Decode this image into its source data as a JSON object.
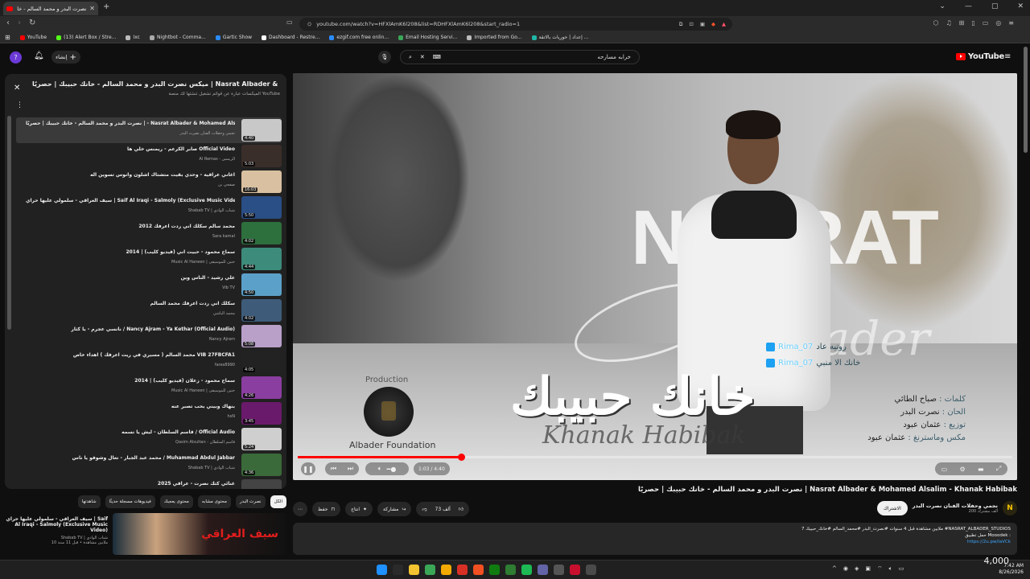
{
  "browser": {
    "tab_title": "نصرت البدر و محمد السالم - خا",
    "url": "youtube.com/watch?v=HFXlAmK6l208&list=RDHFXlAmK6l208&start_radio=1",
    "bookmarks": [
      "YouTube",
      "(13) Alert Box / Stre...",
      "Ixc",
      "Nightbot - Comma...",
      "Gartic Show",
      "Dashboard - Restre...",
      "ezgif.com free onlin...",
      "Email Hosting Servi...",
      "Imported from Go...",
      "إعداد | حوريات بالاتقة ..."
    ],
    "bookmark_colors": [
      "#ff0000",
      "#53fc18",
      "#bbbbbb",
      "#aaaaaa",
      "#2a8cff",
      "#ffffff",
      "#2a8cff",
      "#3aa757",
      "#bbbbbb",
      "#1fb6a8"
    ]
  },
  "masthead": {
    "create_label": "إنشاء",
    "search_value": "خرابه مسارحه",
    "logo_text": "YouTube"
  },
  "playlist": {
    "title": "ميكس نصرت البدر و محمد السالم - خانك حبيبك | حصريًا | Nasrat Albader & Mohamed Alsalim - Khanak Habibak",
    "subtitle": "الميكسات عبارة عن قوائم تشغيل تنشئها لك منصة YouTube",
    "items": [
      {
        "title": "نصرت البدر و محمد السالم - خانك حبيبك | حصريًا | - Nasrat Albader & Mohamed Alsalim - Khanak Habibak",
        "channel": "نجمي وحفلات الفنان نصرت البدر",
        "duration": "4:40",
        "color": "#c8c8c8"
      },
      {
        "title": "صابر الكرعم - ريمنس خلي ها Official Video",
        "channel": "Al Remas - الريمس",
        "duration": "5:03",
        "color": "#3a2e2a"
      },
      {
        "title": "اغاني عراقية - وحدي بقيت متشتاك اشلون وانوس تسوين اله",
        "channel": "صفحي بن",
        "duration": "16:03",
        "color": "#d9c0a0"
      },
      {
        "title": "سيف العراقي - سلمولي عليها حراي | Saif Al Iraqi - Salmoly (Exclusive Music Video)",
        "channel": "Shabab TV | شباب الوادي",
        "duration": "5:50",
        "color": "#2a4e86"
      },
      {
        "title": "محمد سالم سكلك اني ردت اعرفك 2012",
        "channel": "Sara kamal",
        "duration": "4:02",
        "color": "#2e6f3e"
      },
      {
        "title": "سماح محمود - حبيت اني (فيديو كليب) | 2014",
        "channel": "Music Al Haneen | حنين للموسيقى",
        "duration": "4:44",
        "color": "#3d8b7a"
      },
      {
        "title": "علي رشيد - الناس وين",
        "channel": "Vib TV",
        "duration": "4:50",
        "color": "#5aa0c8"
      },
      {
        "title": "سكلك اني ردت اعرفك محمد السالم",
        "channel": "محمد الباشي",
        "duration": "4:02",
        "color": "#3e5c7a"
      },
      {
        "title": "نانسي عجرم - يا كثار / Nancy Ajram - Ya Kethar (Official Audio)",
        "channel": "Nancy Ajram",
        "duration": "5:08",
        "color": "#b8a0c8"
      },
      {
        "title": "محمد السالم ( مسيري في ريت اعرفك ) اهداء خاص VIB 27FBCFA1",
        "channel": "fares8990",
        "duration": "4:05",
        "color": "#222222"
      },
      {
        "title": "سماح محمود - زعلان (فيديو كليب) | 2014",
        "channel": "Music Al Haneen | حنين للموسيقى",
        "duration": "4:26",
        "color": "#8a3ea0"
      },
      {
        "title": "بنهاك وبيني بحب تصبر عنه",
        "channel": "hsN",
        "duration": "3:45",
        "color": "#6a1a6a"
      },
      {
        "title": "قاسم السلطان - ليش يا نسمه / Official Audio",
        "channel": "Qasim Alsultan - قاسم السلطان",
        "duration": "5:24",
        "color": "#cfcfcf"
      },
      {
        "title": "محمد عبد الجبار - تعال وشوفو يا ناس / Muhammad Abdul Jabbar",
        "channel": "Shabab TV | شباب الوادي",
        "duration": "4:36",
        "color": "#3a6a3a"
      },
      {
        "title": "غنائي كتك نصرت - عراقي 2025",
        "channel": "",
        "duration": "",
        "color": "#444444"
      }
    ]
  },
  "chips": [
    "الكل",
    "نصرت البدر",
    "محتوى مشابه",
    "محتوى يعجبك",
    "فيديوهات مسجلة حديثًا",
    "شاهدتها"
  ],
  "recommended": {
    "title": "سيف العراقي - سلمولي عليها حراي | Saif Al Iraqi - Salmoly (Exclusive Music Video)",
    "channel": "Shabab TV | شباب الوادي",
    "meta": "10 ملايين مشاهدة • قبل 11 سنة",
    "thumb_text": "سيف العراقي"
  },
  "player": {
    "production_label": "Production",
    "foundation": "Albader Foundation",
    "overlay_name": "NASRAT",
    "signature": "Albader",
    "song_ar": "خانك حبيبك",
    "song_en": "Khanak Habibak",
    "credits": [
      {
        "k": "كلمات :",
        "v": "صباح الطائي"
      },
      {
        "k": "الحان :",
        "v": "نصرت البدر"
      },
      {
        "k": "توزيع :",
        "v": "عثمان عبود"
      },
      {
        "k": "مكس وماسترنغ :",
        "v": "عثمان عبود"
      }
    ],
    "social": [
      {
        "handle": "Rima_07",
        "label": "روتيه عاد"
      },
      {
        "handle": "Rima_07",
        "label": "خانك الا منبي"
      }
    ],
    "time": "1:03 / 4:40",
    "progress": 0.2284
  },
  "video": {
    "title": "نصرت البدر و محمد السالم - خانك حبيبك | حصريًا | Nasrat Albader & Mohamed Alsalim - Khanak Habibak",
    "likes": "73 ألف",
    "share": "مشاركة",
    "clip": "انتاج",
    "save": "حفظ",
    "channel_name": "نجمي وحفلات الفنان نصرت البدر",
    "channel_subs": "200 ألف مشترك",
    "subscribe": "الاشتراك",
    "desc_line1": "7 ملايين مشاهدة قبل 4 سنوات  #نصرت_البدر #محمد_السالم #خانك_حبيبك #NASRAT_ALBADER_STUDIOS",
    "desc_line2": "حمل تطبيق Mooodek :",
    "desc_link": "https://2u.pw/laVCk"
  },
  "taskbar": {
    "time": "7:42 AM",
    "date": "8/26/2026",
    "counter": "4,000",
    "icon_colors": [
      "#1e90ff",
      "#2a2a2a",
      "#f4c430",
      "#3aa757",
      "#f2a900",
      "#d93025",
      "#f25022",
      "#107c10",
      "#2e7d32",
      "#1db954",
      "#6264a7",
      "#555555",
      "#c8102e",
      "#4a4a4a"
    ]
  }
}
